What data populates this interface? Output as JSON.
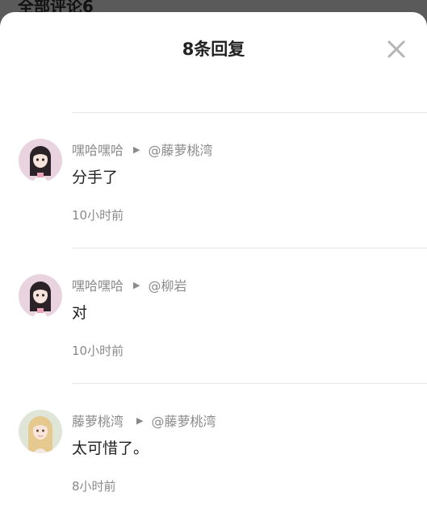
{
  "behind_title": "全部评论6",
  "sheet": {
    "title": "8条回复",
    "close_icon": "close-icon"
  },
  "comments": [
    {
      "author": "嘿哈嘿哈",
      "reply_to": "@藤萝桃湾",
      "text": "分手了",
      "time": "10小时前",
      "avatar": "avatar-girl-dark-hair"
    },
    {
      "author": "嘿哈嘿哈",
      "reply_to": "@柳岩",
      "text": "对",
      "time": "10小时前",
      "avatar": "avatar-girl-dark-hair"
    },
    {
      "author": "藤萝桃湾",
      "reply_to": "@藤萝桃湾",
      "text": "太可惜了。",
      "time": "8小时前",
      "avatar": "avatar-girl-blonde-hair"
    }
  ],
  "colors": {
    "overlay": "#5a5a5a",
    "sheet_bg": "#ffffff",
    "meta_text": "#8a8a8a",
    "main_text": "#222222"
  }
}
